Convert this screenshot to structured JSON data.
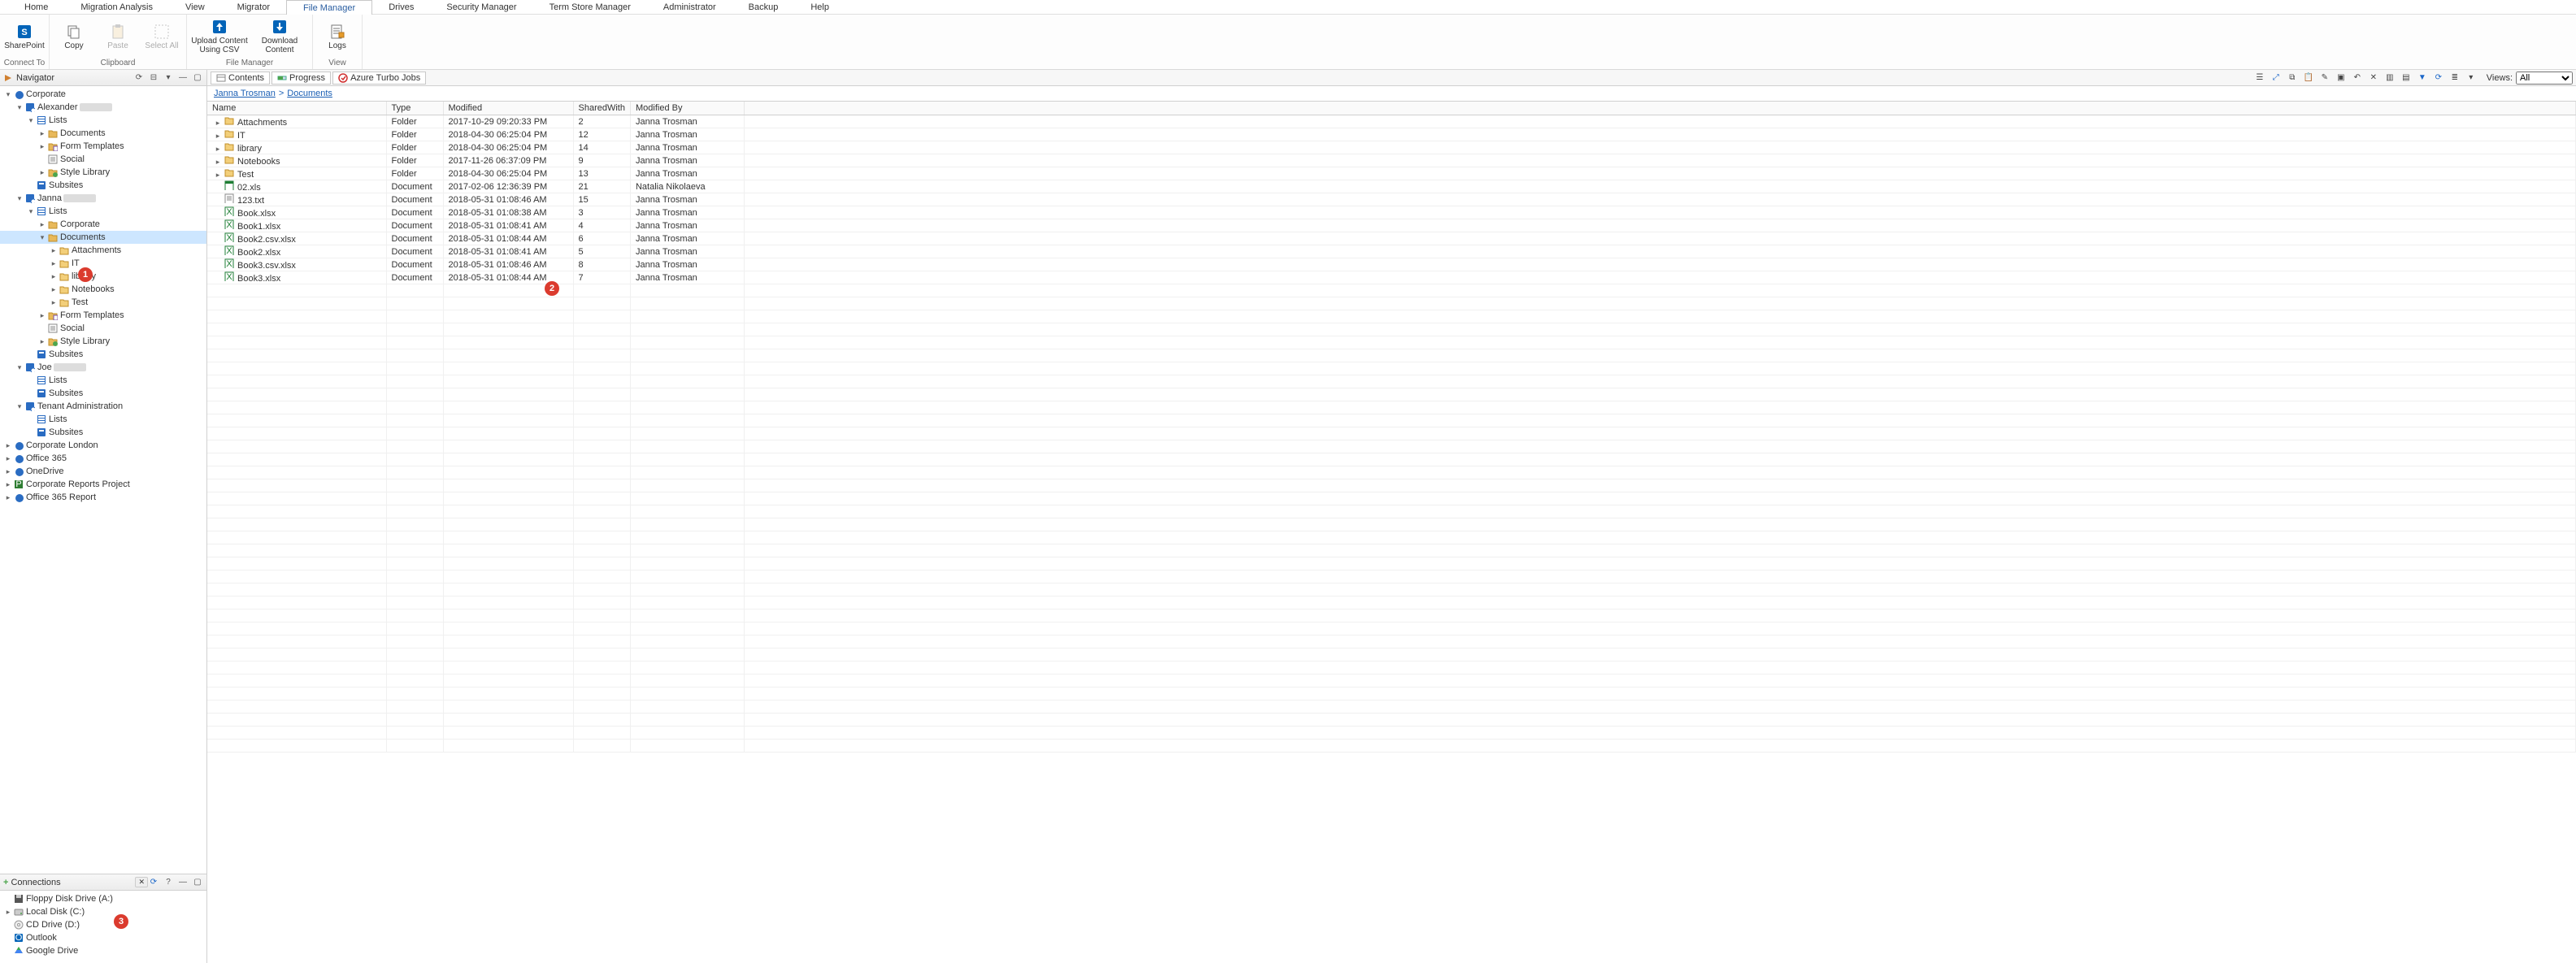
{
  "menu": {
    "items": [
      "Home",
      "Migration Analysis",
      "View",
      "Migrator",
      "File Manager",
      "Drives",
      "Security Manager",
      "Term Store Manager",
      "Administrator",
      "Backup",
      "Help"
    ],
    "active": 4
  },
  "ribbon": {
    "groups": [
      {
        "label": "Connect To",
        "buttons": [
          {
            "name": "sharepoint-button",
            "label": "SharePoint",
            "icon": "sharepoint",
            "enabled": true,
            "wide": false
          }
        ]
      },
      {
        "label": "Clipboard",
        "buttons": [
          {
            "name": "copy-button",
            "label": "Copy",
            "icon": "copy",
            "enabled": true
          },
          {
            "name": "paste-button",
            "label": "Paste",
            "icon": "paste",
            "enabled": false
          },
          {
            "name": "select-all-button",
            "label": "Select All",
            "icon": "selectall",
            "enabled": false
          }
        ]
      },
      {
        "label": "File Manager",
        "buttons": [
          {
            "name": "upload-content-button",
            "label": "Upload Content Using CSV",
            "icon": "upload",
            "enabled": true,
            "wide": true
          },
          {
            "name": "download-content-button",
            "label": "Download Content",
            "icon": "download",
            "enabled": true,
            "wide": true
          }
        ]
      },
      {
        "label": "View",
        "buttons": [
          {
            "name": "logs-button",
            "label": "Logs",
            "icon": "logs",
            "enabled": true
          }
        ]
      }
    ]
  },
  "navigator": {
    "title": "Navigator",
    "tree": [
      {
        "d": 0,
        "exp": "open",
        "icon": "site",
        "label": "Corporate"
      },
      {
        "d": 1,
        "exp": "open",
        "icon": "usersite",
        "label": "Alexander",
        "redact": true
      },
      {
        "d": 2,
        "exp": "open",
        "icon": "lists",
        "label": "Lists"
      },
      {
        "d": 3,
        "exp": "closed",
        "icon": "doclib",
        "label": "Documents"
      },
      {
        "d": 3,
        "exp": "closed",
        "icon": "formlib",
        "label": "Form Templates"
      },
      {
        "d": 3,
        "exp": "none",
        "icon": "list",
        "label": "Social"
      },
      {
        "d": 3,
        "exp": "closed",
        "icon": "stylib",
        "label": "Style Library"
      },
      {
        "d": 2,
        "exp": "none",
        "icon": "subsites",
        "label": "Subsites"
      },
      {
        "d": 1,
        "exp": "open",
        "icon": "usersite",
        "label": "Janna",
        "redact": true
      },
      {
        "d": 2,
        "exp": "open",
        "icon": "lists",
        "label": "Lists"
      },
      {
        "d": 3,
        "exp": "closed",
        "icon": "doclib",
        "label": "Corporate"
      },
      {
        "d": 3,
        "exp": "open",
        "icon": "doclib",
        "label": "Documents",
        "sel": true
      },
      {
        "d": 4,
        "exp": "closed",
        "icon": "folder",
        "label": "Attachments"
      },
      {
        "d": 4,
        "exp": "closed",
        "icon": "folder",
        "label": "IT"
      },
      {
        "d": 4,
        "exp": "closed",
        "icon": "folder",
        "label": "library"
      },
      {
        "d": 4,
        "exp": "closed",
        "icon": "folder",
        "label": "Notebooks"
      },
      {
        "d": 4,
        "exp": "closed",
        "icon": "folder",
        "label": "Test"
      },
      {
        "d": 3,
        "exp": "closed",
        "icon": "formlib",
        "label": "Form Templates"
      },
      {
        "d": 3,
        "exp": "none",
        "icon": "list",
        "label": "Social"
      },
      {
        "d": 3,
        "exp": "closed",
        "icon": "stylib",
        "label": "Style Library"
      },
      {
        "d": 2,
        "exp": "none",
        "icon": "subsites",
        "label": "Subsites"
      },
      {
        "d": 1,
        "exp": "open",
        "icon": "usersite",
        "label": "Joe",
        "redact": true
      },
      {
        "d": 2,
        "exp": "none",
        "icon": "lists",
        "label": "Lists"
      },
      {
        "d": 2,
        "exp": "none",
        "icon": "subsites",
        "label": "Subsites"
      },
      {
        "d": 1,
        "exp": "open",
        "icon": "usersite",
        "label": "Tenant Administration"
      },
      {
        "d": 2,
        "exp": "none",
        "icon": "lists",
        "label": "Lists"
      },
      {
        "d": 2,
        "exp": "none",
        "icon": "subsites",
        "label": "Subsites"
      },
      {
        "d": 0,
        "exp": "closed",
        "icon": "site",
        "label": "Corporate London"
      },
      {
        "d": 0,
        "exp": "closed",
        "icon": "site",
        "label": "Office 365"
      },
      {
        "d": 0,
        "exp": "closed",
        "icon": "site",
        "label": "OneDrive"
      },
      {
        "d": 0,
        "exp": "closed",
        "icon": "proj",
        "label": "Corporate Reports Project"
      },
      {
        "d": 0,
        "exp": "closed",
        "icon": "site",
        "label": "Office 365 Report"
      }
    ]
  },
  "connections": {
    "title": "Connections",
    "items": [
      {
        "icon": "floppy",
        "label": "Floppy Disk Drive (A:)"
      },
      {
        "icon": "disk",
        "label": "Local Disk (C:)",
        "exp": "closed"
      },
      {
        "icon": "cd",
        "label": "CD Drive (D:)"
      },
      {
        "icon": "outlook",
        "label": "Outlook"
      },
      {
        "icon": "gdrive",
        "label": "Google Drive"
      }
    ]
  },
  "contentTabs": {
    "items": [
      {
        "name": "tab-contents",
        "label": "Contents",
        "icon": "contents"
      },
      {
        "name": "tab-progress",
        "label": "Progress",
        "icon": "progress"
      },
      {
        "name": "tab-azure-jobs",
        "label": "Azure Turbo Jobs",
        "icon": "azure"
      }
    ],
    "viewsLabel": "Views:",
    "viewsValue": "All"
  },
  "breadcrumb": {
    "parts": [
      "Janna Trosman",
      "Documents"
    ]
  },
  "grid": {
    "columns": [
      "Name",
      "Type",
      "Modified",
      "SharedWith",
      "Modified By"
    ],
    "rows": [
      {
        "twist": "closed",
        "icon": "folder",
        "name": "Attachments",
        "type": "Folder",
        "modified": "2017-10-29 09:20:33 PM",
        "shared": "2",
        "by": "Janna Trosman"
      },
      {
        "twist": "closed",
        "icon": "folder",
        "name": "IT",
        "type": "Folder",
        "modified": "2018-04-30 06:25:04 PM",
        "shared": "12",
        "by": "Janna Trosman"
      },
      {
        "twist": "closed",
        "icon": "folder",
        "name": "library",
        "type": "Folder",
        "modified": "2018-04-30 06:25:04 PM",
        "shared": "14",
        "by": "Janna Trosman"
      },
      {
        "twist": "closed",
        "icon": "folder",
        "name": "Notebooks",
        "type": "Folder",
        "modified": "2017-11-26 06:37:09 PM",
        "shared": "9",
        "by": "Janna Trosman"
      },
      {
        "twist": "closed",
        "icon": "folder",
        "name": "Test",
        "type": "Folder",
        "modified": "2018-04-30 06:25:04 PM",
        "shared": "13",
        "by": "Janna Trosman"
      },
      {
        "twist": "none",
        "icon": "xls",
        "name": "02.xls",
        "type": "Document",
        "modified": "2017-02-06 12:36:39 PM",
        "shared": "21",
        "by": "Natalia Nikolaeva"
      },
      {
        "twist": "none",
        "icon": "txt",
        "name": "123.txt",
        "type": "Document",
        "modified": "2018-05-31 01:08:46 AM",
        "shared": "15",
        "by": "Janna Trosman"
      },
      {
        "twist": "none",
        "icon": "xlsx",
        "name": "Book.xlsx",
        "type": "Document",
        "modified": "2018-05-31 01:08:38 AM",
        "shared": "3",
        "by": "Janna Trosman"
      },
      {
        "twist": "none",
        "icon": "xlsx",
        "name": "Book1.xlsx",
        "type": "Document",
        "modified": "2018-05-31 01:08:41 AM",
        "shared": "4",
        "by": "Janna Trosman"
      },
      {
        "twist": "none",
        "icon": "xlsx",
        "name": "Book2.csv.xlsx",
        "type": "Document",
        "modified": "2018-05-31 01:08:44 AM",
        "shared": "6",
        "by": "Janna Trosman"
      },
      {
        "twist": "none",
        "icon": "xlsx",
        "name": "Book2.xlsx",
        "type": "Document",
        "modified": "2018-05-31 01:08:41 AM",
        "shared": "5",
        "by": "Janna Trosman"
      },
      {
        "twist": "none",
        "icon": "xlsx",
        "name": "Book3.csv.xlsx",
        "type": "Document",
        "modified": "2018-05-31 01:08:46 AM",
        "shared": "8",
        "by": "Janna Trosman"
      },
      {
        "twist": "none",
        "icon": "xlsx",
        "name": "Book3.xlsx",
        "type": "Document",
        "modified": "2018-05-31 01:08:44 AM",
        "shared": "7",
        "by": "Janna Trosman"
      }
    ],
    "emptyRows": 36
  },
  "badges": {
    "1": "1",
    "2": "2",
    "3": "3"
  }
}
